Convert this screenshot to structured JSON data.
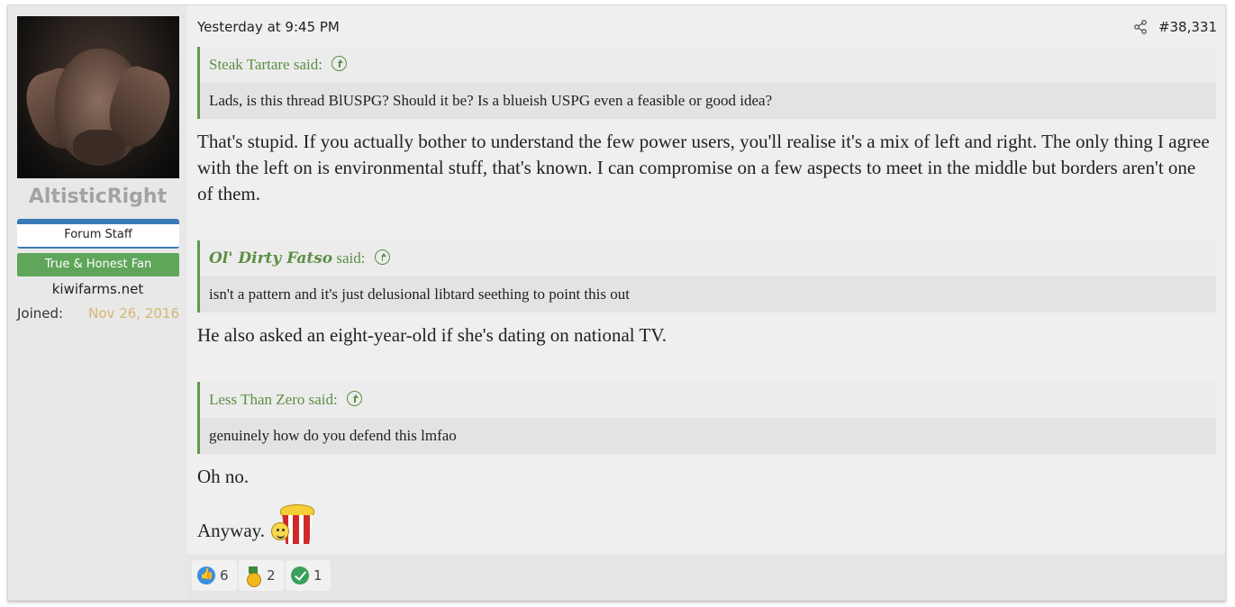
{
  "user": {
    "name": "AltisticRight",
    "banner_primary": "Forum Staff",
    "banner_secondary": "True & Honest Fan",
    "site": "kiwifarms.net",
    "joined_label": "Joined:",
    "joined_date": "Nov 26, 2016"
  },
  "post": {
    "date": "Yesterday at 9:45 PM",
    "number": "#38,331",
    "share_icon": "share-icon"
  },
  "quotes": [
    {
      "author": "Steak Tartare",
      "said": "said:",
      "text": "Lads, is this thread BlUSPG? Should it be? Is a blueish USPG even a feasible or good idea?"
    },
    {
      "author": "Ol' Dirty Fatso",
      "said": "said:",
      "text": "isn't a pattern and it's just delusional libtard seething to point this out"
    },
    {
      "author": "Less Than Zero",
      "said": "said:",
      "text": "genuinely how do you defend this lmfao"
    }
  ],
  "replies": [
    "That's stupid. If you actually bother to understand the few power users, you'll realise it's a mix of left and right. The only thing I agree with the left on is environmental stuff, that's known. I can compromise on a few aspects to meet in the middle but borders aren't one of them.",
    "He also asked an eight-year-old if she's dating on national TV.",
    "Oh no.",
    "Anyway."
  ],
  "reactions": [
    {
      "icon": "like-icon",
      "count": "6"
    },
    {
      "icon": "medal-icon",
      "count": "2"
    },
    {
      "icon": "check-icon",
      "count": "1"
    }
  ],
  "colors": {
    "staff_banner": "#3a7ab5",
    "fan_banner": "#5fa55a",
    "quote_accent": "#5c8f45",
    "joined_date": "#d6b773"
  }
}
